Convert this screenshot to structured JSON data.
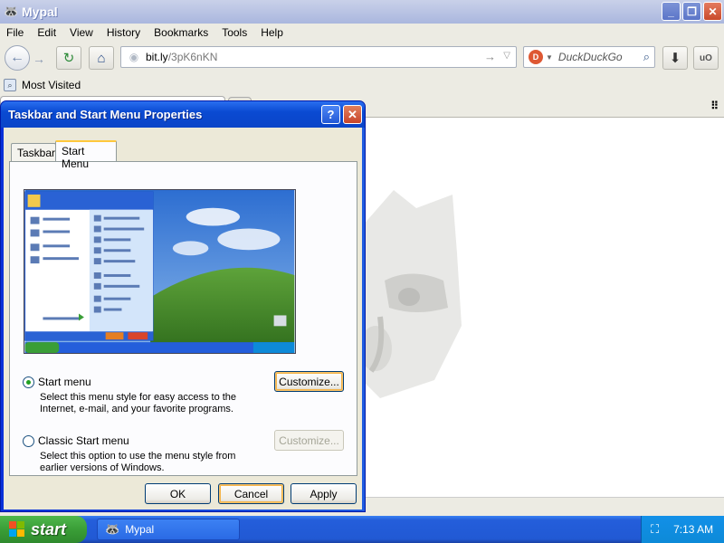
{
  "browser": {
    "title": "Mypal",
    "menu": [
      "File",
      "Edit",
      "View",
      "History",
      "Bookmarks",
      "Tools",
      "Help"
    ],
    "url_host": "bit.ly",
    "url_path": "/3pK6nKN",
    "search_placeholder": "DuckDuckGo",
    "bookmark_label": "Most Visited",
    "window_buttons": {
      "minimize": "_",
      "restore": "❐",
      "close": "✕"
    }
  },
  "dialog": {
    "title": "Taskbar and Start Menu Properties",
    "help_glyph": "?",
    "close_glyph": "✕",
    "tabs": [
      "Taskbar",
      "Start Menu"
    ],
    "active_tab": "Start Menu",
    "options": [
      {
        "label": "Start menu",
        "description": "Select this menu style for easy access to the Internet, e-mail, and your favorite programs.",
        "selected": true,
        "customize": "Customize...",
        "customize_enabled": true
      },
      {
        "label": "Classic Start menu",
        "description": "Select this option to use the menu style from earlier versions of Windows.",
        "selected": false,
        "customize": "Customize...",
        "customize_enabled": false
      }
    ],
    "buttons": {
      "ok": "OK",
      "cancel": "Cancel",
      "apply": "Apply"
    }
  },
  "taskbar": {
    "start_label": "start",
    "task_label": "Mypal",
    "clock": "7:13 AM"
  },
  "colors": {
    "xp_blue": "#245edb",
    "start_green": "#3a9e37",
    "dialog_bg": "#ece9d8"
  }
}
